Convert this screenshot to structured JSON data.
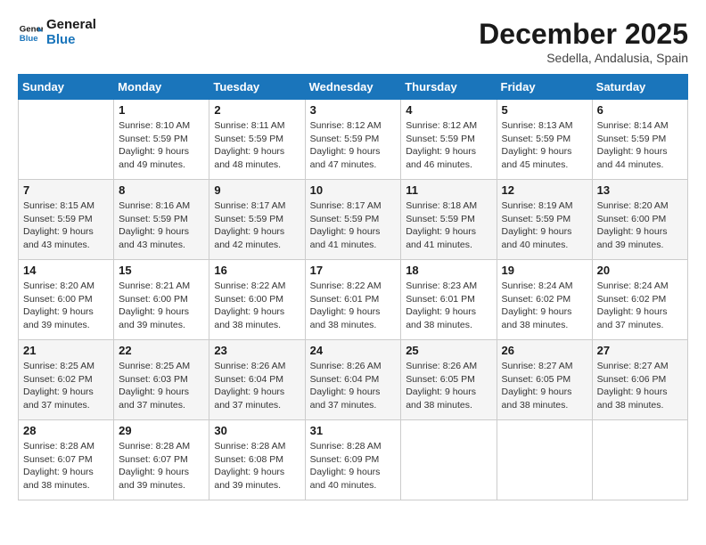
{
  "logo": {
    "line1": "General",
    "line2": "Blue"
  },
  "title": "December 2025",
  "subtitle": "Sedella, Andalusia, Spain",
  "days_of_week": [
    "Sunday",
    "Monday",
    "Tuesday",
    "Wednesday",
    "Thursday",
    "Friday",
    "Saturday"
  ],
  "weeks": [
    [
      {
        "num": "",
        "info": ""
      },
      {
        "num": "1",
        "info": "Sunrise: 8:10 AM\nSunset: 5:59 PM\nDaylight: 9 hours\nand 49 minutes."
      },
      {
        "num": "2",
        "info": "Sunrise: 8:11 AM\nSunset: 5:59 PM\nDaylight: 9 hours\nand 48 minutes."
      },
      {
        "num": "3",
        "info": "Sunrise: 8:12 AM\nSunset: 5:59 PM\nDaylight: 9 hours\nand 47 minutes."
      },
      {
        "num": "4",
        "info": "Sunrise: 8:12 AM\nSunset: 5:59 PM\nDaylight: 9 hours\nand 46 minutes."
      },
      {
        "num": "5",
        "info": "Sunrise: 8:13 AM\nSunset: 5:59 PM\nDaylight: 9 hours\nand 45 minutes."
      },
      {
        "num": "6",
        "info": "Sunrise: 8:14 AM\nSunset: 5:59 PM\nDaylight: 9 hours\nand 44 minutes."
      }
    ],
    [
      {
        "num": "7",
        "info": "Sunrise: 8:15 AM\nSunset: 5:59 PM\nDaylight: 9 hours\nand 43 minutes."
      },
      {
        "num": "8",
        "info": "Sunrise: 8:16 AM\nSunset: 5:59 PM\nDaylight: 9 hours\nand 43 minutes."
      },
      {
        "num": "9",
        "info": "Sunrise: 8:17 AM\nSunset: 5:59 PM\nDaylight: 9 hours\nand 42 minutes."
      },
      {
        "num": "10",
        "info": "Sunrise: 8:17 AM\nSunset: 5:59 PM\nDaylight: 9 hours\nand 41 minutes."
      },
      {
        "num": "11",
        "info": "Sunrise: 8:18 AM\nSunset: 5:59 PM\nDaylight: 9 hours\nand 41 minutes."
      },
      {
        "num": "12",
        "info": "Sunrise: 8:19 AM\nSunset: 5:59 PM\nDaylight: 9 hours\nand 40 minutes."
      },
      {
        "num": "13",
        "info": "Sunrise: 8:20 AM\nSunset: 6:00 PM\nDaylight: 9 hours\nand 39 minutes."
      }
    ],
    [
      {
        "num": "14",
        "info": "Sunrise: 8:20 AM\nSunset: 6:00 PM\nDaylight: 9 hours\nand 39 minutes."
      },
      {
        "num": "15",
        "info": "Sunrise: 8:21 AM\nSunset: 6:00 PM\nDaylight: 9 hours\nand 39 minutes."
      },
      {
        "num": "16",
        "info": "Sunrise: 8:22 AM\nSunset: 6:00 PM\nDaylight: 9 hours\nand 38 minutes."
      },
      {
        "num": "17",
        "info": "Sunrise: 8:22 AM\nSunset: 6:01 PM\nDaylight: 9 hours\nand 38 minutes."
      },
      {
        "num": "18",
        "info": "Sunrise: 8:23 AM\nSunset: 6:01 PM\nDaylight: 9 hours\nand 38 minutes."
      },
      {
        "num": "19",
        "info": "Sunrise: 8:24 AM\nSunset: 6:02 PM\nDaylight: 9 hours\nand 38 minutes."
      },
      {
        "num": "20",
        "info": "Sunrise: 8:24 AM\nSunset: 6:02 PM\nDaylight: 9 hours\nand 37 minutes."
      }
    ],
    [
      {
        "num": "21",
        "info": "Sunrise: 8:25 AM\nSunset: 6:02 PM\nDaylight: 9 hours\nand 37 minutes."
      },
      {
        "num": "22",
        "info": "Sunrise: 8:25 AM\nSunset: 6:03 PM\nDaylight: 9 hours\nand 37 minutes."
      },
      {
        "num": "23",
        "info": "Sunrise: 8:26 AM\nSunset: 6:04 PM\nDaylight: 9 hours\nand 37 minutes."
      },
      {
        "num": "24",
        "info": "Sunrise: 8:26 AM\nSunset: 6:04 PM\nDaylight: 9 hours\nand 37 minutes."
      },
      {
        "num": "25",
        "info": "Sunrise: 8:26 AM\nSunset: 6:05 PM\nDaylight: 9 hours\nand 38 minutes."
      },
      {
        "num": "26",
        "info": "Sunrise: 8:27 AM\nSunset: 6:05 PM\nDaylight: 9 hours\nand 38 minutes."
      },
      {
        "num": "27",
        "info": "Sunrise: 8:27 AM\nSunset: 6:06 PM\nDaylight: 9 hours\nand 38 minutes."
      }
    ],
    [
      {
        "num": "28",
        "info": "Sunrise: 8:28 AM\nSunset: 6:07 PM\nDaylight: 9 hours\nand 38 minutes."
      },
      {
        "num": "29",
        "info": "Sunrise: 8:28 AM\nSunset: 6:07 PM\nDaylight: 9 hours\nand 39 minutes."
      },
      {
        "num": "30",
        "info": "Sunrise: 8:28 AM\nSunset: 6:08 PM\nDaylight: 9 hours\nand 39 minutes."
      },
      {
        "num": "31",
        "info": "Sunrise: 8:28 AM\nSunset: 6:09 PM\nDaylight: 9 hours\nand 40 minutes."
      },
      {
        "num": "",
        "info": ""
      },
      {
        "num": "",
        "info": ""
      },
      {
        "num": "",
        "info": ""
      }
    ]
  ]
}
